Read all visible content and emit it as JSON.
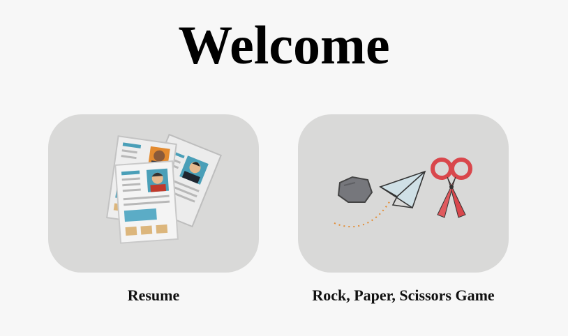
{
  "page": {
    "title": "Welcome"
  },
  "cards": [
    {
      "label": "Resume",
      "icon": "resume-documents-icon"
    },
    {
      "label": "Rock, Paper, Scissors Game",
      "icon": "rock-paper-scissors-icon"
    }
  ],
  "colors": {
    "background": "#f7f7f7",
    "card": "#d9d9d8",
    "accent_teal": "#4a9fb8",
    "accent_orange": "#e38a2f",
    "scissors_red": "#d9474c"
  }
}
